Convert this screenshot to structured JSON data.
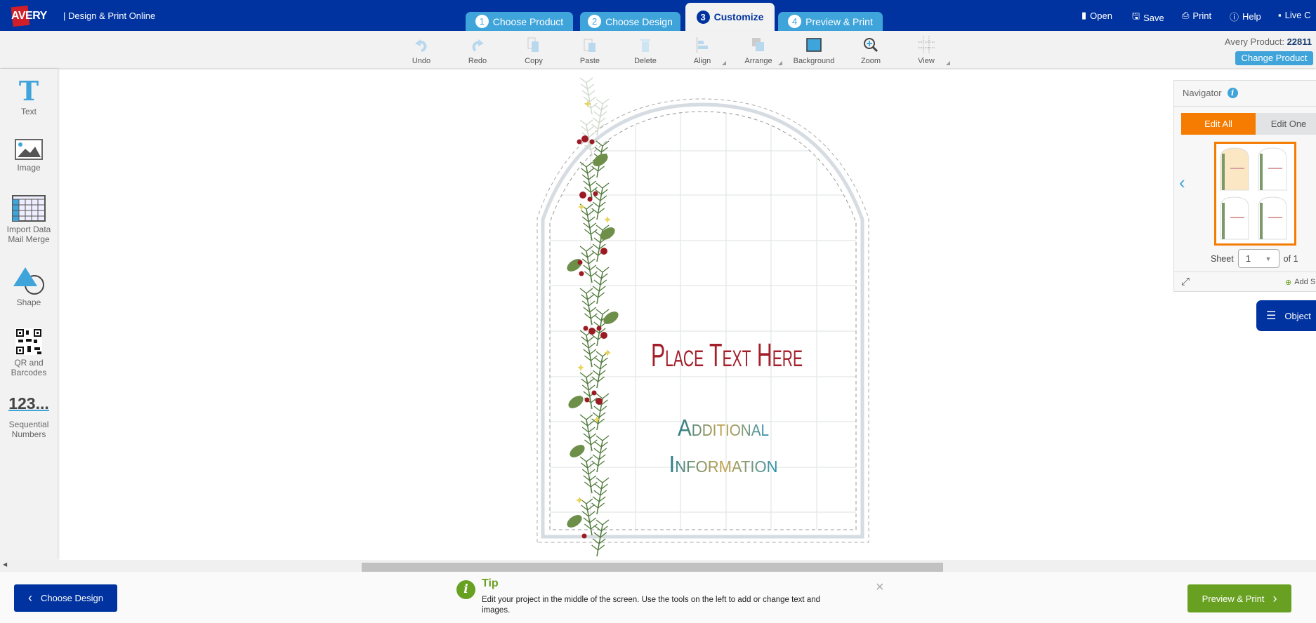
{
  "header": {
    "brand": "AVERY",
    "app_title": "|  Design & Print Online",
    "tabs": [
      {
        "num": "1",
        "label": "Choose Product"
      },
      {
        "num": "2",
        "label": "Choose Design"
      },
      {
        "num": "3",
        "label": "Customize",
        "active": true
      },
      {
        "num": "4",
        "label": "Preview & Print"
      }
    ],
    "links": [
      {
        "label": "Open",
        "icon": "open-icon"
      },
      {
        "label": "Save",
        "icon": "save-icon"
      },
      {
        "label": "Print",
        "icon": "print-icon"
      },
      {
        "label": "Help",
        "icon": "help-icon"
      },
      {
        "label": "Live C",
        "icon": "chat-icon"
      }
    ]
  },
  "toolbar": {
    "items": [
      {
        "label": "Undo"
      },
      {
        "label": "Redo"
      },
      {
        "label": "Copy"
      },
      {
        "label": "Paste"
      },
      {
        "label": "Delete"
      },
      {
        "label": "Align"
      },
      {
        "label": "Arrange"
      },
      {
        "label": "Background"
      },
      {
        "label": "Zoom"
      },
      {
        "label": "View"
      }
    ],
    "product_label": "Avery Product: ",
    "product_number": "22811",
    "change_product": "Change Product"
  },
  "sidebar": {
    "items": [
      {
        "label": "Text"
      },
      {
        "label": "Image"
      },
      {
        "label": "Import Data Mail Merge"
      },
      {
        "label": "Shape"
      },
      {
        "label": "QR and Barcodes"
      },
      {
        "label": "Sequential Numbers"
      }
    ],
    "seq_glyph": "123..."
  },
  "label": {
    "title": "Place Text Here",
    "line1": "Additional",
    "line2": "Information",
    "title_color": "#a31f2a"
  },
  "navigator": {
    "title": "Navigator",
    "edit_all": "Edit All",
    "edit_one": "Edit One",
    "sheet_label": "Sheet",
    "sheet_value": "1",
    "of_label": "of 1",
    "add_sheet": "Add S"
  },
  "object_button": "Object",
  "footer": {
    "back": "Choose Design",
    "next": "Preview & Print",
    "tip_title": "Tip",
    "tip_text": "Edit your project in the middle of the screen. Use the tools on the left to add or change text and images.",
    "close": "×"
  },
  "colors": {
    "header": "#0033a0",
    "tab": "#3fa4da",
    "accent_orange": "#f57c00",
    "green": "#68a121"
  }
}
